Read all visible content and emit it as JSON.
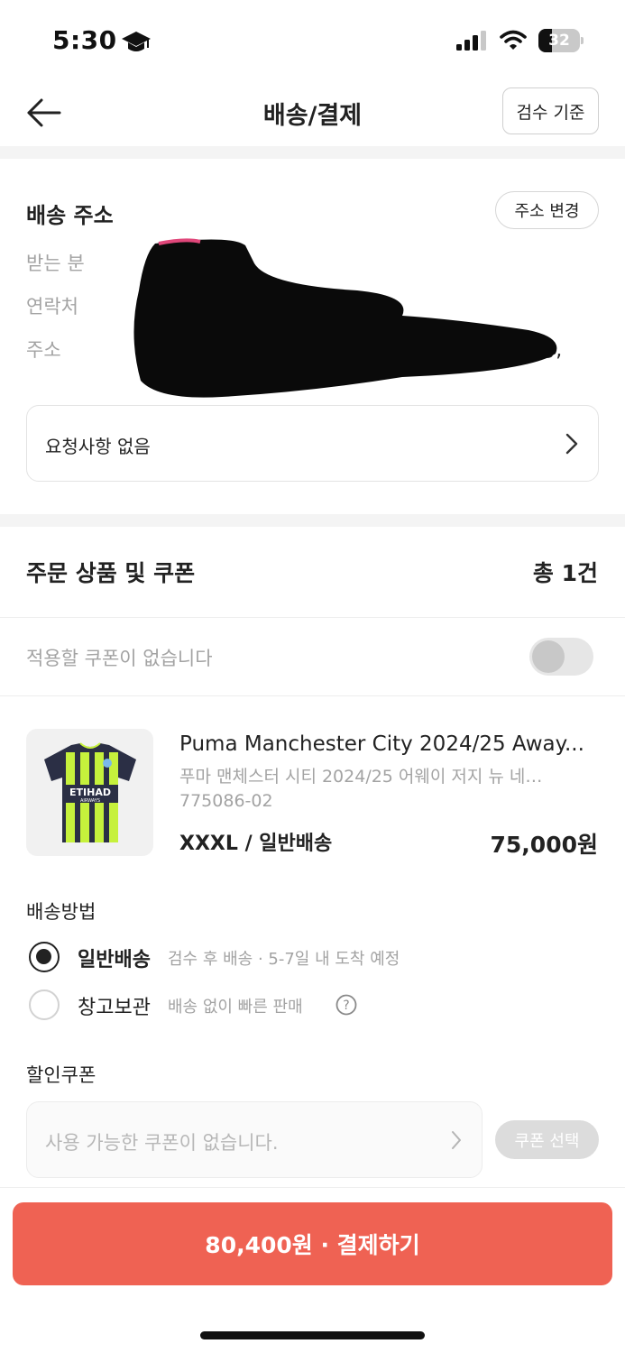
{
  "status_bar": {
    "time": "5:30",
    "battery": "32",
    "battery_level": 0.32,
    "icons": [
      "graduation-cap-icon",
      "signal-icon",
      "wifi-icon",
      "battery-icon"
    ]
  },
  "header": {
    "title": "배송/결제",
    "inspect_button": "검수 기준",
    "back_icon": "arrow-left-icon"
  },
  "address": {
    "title": "배송 주소",
    "change_button": "주소 변경",
    "labels": {
      "recipient": "받는 분",
      "contact": "연락처",
      "address": "주소"
    },
    "address_tail": "동,",
    "request": "요청사항 없음"
  },
  "order": {
    "title": "주문 상품 및 쿠폰",
    "count": "총 1건",
    "coupon_notice": "적용할 쿠폰이 없습니다",
    "coupon_toggle_on": false
  },
  "product": {
    "name": "Puma Manchester City 2024/25 Away...",
    "sub_name": "푸마 맨체스터 시티 2024/25 어웨이 저지 뉴 네…",
    "code": "775086-02",
    "option": "XXXL / 일반배송",
    "price": "75,000원",
    "jersey_colors": {
      "base": "#2b2f45",
      "stripe": "#c6f13c"
    },
    "jersey_text": {
      "sponsor": "ETIHAD",
      "sub": "AIRWAYS"
    }
  },
  "delivery": {
    "title": "배송방법",
    "options": [
      {
        "label": "일반배송",
        "desc": "검수 후 배송 · 5-7일 내 도착 예정",
        "selected": true
      },
      {
        "label": "창고보관",
        "desc": "배송 없이 빠른 판매",
        "selected": false,
        "help": "?"
      }
    ]
  },
  "coupon": {
    "title": "할인쿠폰",
    "placeholder": "사용 가능한 쿠폰이 없습니다.",
    "select_button": "쿠폰 선택"
  },
  "pay": {
    "label": "80,400원 · 결제하기",
    "color": "#ef6253"
  }
}
